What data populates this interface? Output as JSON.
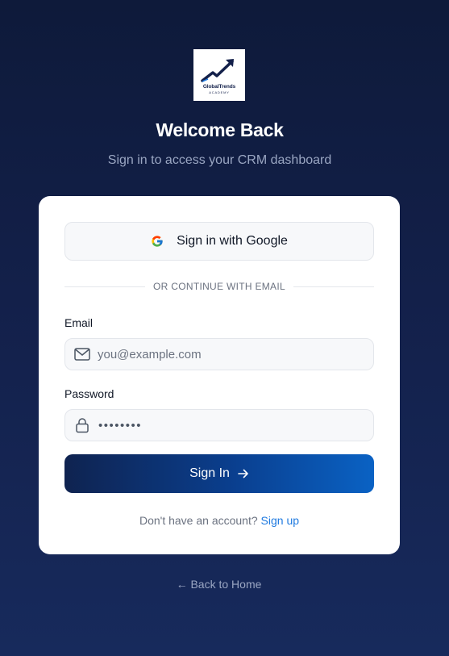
{
  "logo": {
    "name": "GlobalTrends",
    "sub": "ACADEMY"
  },
  "header": {
    "title": "Welcome Back",
    "subtitle": "Sign in to access your CRM dashboard"
  },
  "card": {
    "google_label": "Sign in with Google",
    "divider_text": "OR CONTINUE WITH EMAIL",
    "email_label": "Email",
    "email_placeholder": "you@example.com",
    "password_label": "Password",
    "password_value": "••••••••",
    "signin_label": "Sign In",
    "signup_prompt": "Don't have an account?",
    "signup_link": "Sign up"
  },
  "footer": {
    "back_label": "← Back to Home"
  },
  "colors": {
    "background": "#13204a",
    "accent": "#1f7ae0",
    "button_start": "#0f2350",
    "button_end": "#0a62c4"
  },
  "icons": {
    "google": "google-icon",
    "email": "mail-icon",
    "password": "lock-icon",
    "signin": "arrow-right-icon",
    "logo": "trend-arrow-icon"
  }
}
